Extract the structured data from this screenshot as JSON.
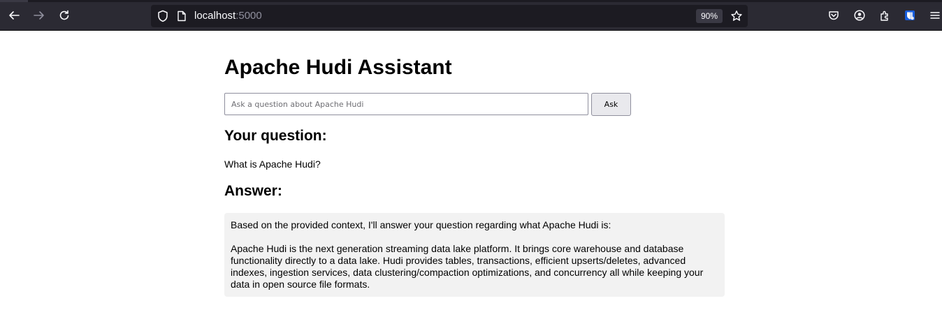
{
  "browser": {
    "url_host": "localhost",
    "url_port": ":5000",
    "zoom": "90%"
  },
  "page": {
    "title": "Apache Hudi Assistant",
    "input_placeholder": "Ask a question about Apache Hudi",
    "input_value": "",
    "ask_label": "Ask",
    "question_heading": "Your question:",
    "question_text": "What is Apache Hudi?",
    "answer_heading": "Answer:",
    "answer_intro": "Based on the provided context, I'll answer your question regarding what Apache Hudi is:",
    "answer_lines": [
      "Apache Hudi is the next generation streaming data lake platform. It brings core warehouse and database",
      "functionality directly to a data lake. Hudi provides tables, transactions, efficient upserts/deletes, advanced",
      "indexes, ingestion services, data clustering/compaction optimizations, and concurrency all while keeping your",
      "data in open source file formats."
    ]
  },
  "icons": [
    "back-icon",
    "forward-icon",
    "reload-icon",
    "shield-icon",
    "page-icon",
    "star-icon",
    "pocket-icon",
    "account-icon",
    "extensions-icon",
    "bitwarden-icon",
    "menu-icon"
  ]
}
